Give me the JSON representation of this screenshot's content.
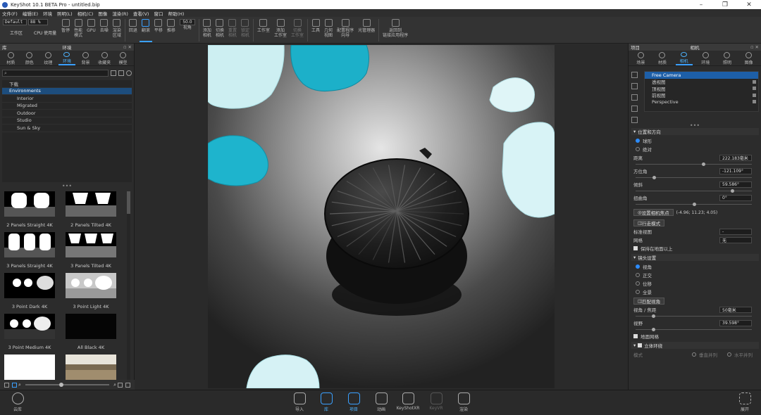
{
  "window": {
    "title": "KeyShot 10.1 BETA Pro  - untitled.bip",
    "minimize": "–",
    "restore": "❐",
    "close": "✕"
  },
  "menu": [
    "文件(F)",
    "编辑(E)",
    "环境",
    "照明(L)",
    "相机(C)",
    "图像",
    "渲染(R)",
    "查看(V)",
    "窗口",
    "帮助(H)"
  ],
  "toolbar": {
    "preset": "Default",
    "zoom": "88 %",
    "workspace_label": "工作区",
    "cpu_label": "CPU 使用量",
    "fov_value": "50.0",
    "buttons": [
      {
        "key": "pause",
        "label": "暂停"
      },
      {
        "key": "perf",
        "label": "性能\n模式"
      },
      {
        "key": "gpu",
        "label": "GPU"
      },
      {
        "key": "denoise",
        "label": "去噪"
      },
      {
        "key": "region",
        "label": "渲染\n区域"
      },
      {
        "key": "sep1",
        "label": ""
      },
      {
        "key": "back",
        "label": "回退"
      },
      {
        "key": "tumble",
        "label": "翻滚",
        "active": true
      },
      {
        "key": "pan",
        "label": "平移"
      },
      {
        "key": "dolly",
        "label": "推移"
      },
      {
        "key": "fov",
        "label": "视角"
      },
      {
        "key": "sep2",
        "label": ""
      },
      {
        "key": "addcam",
        "label": "添加\n相机"
      },
      {
        "key": "switchcam",
        "label": "切换\n相机"
      },
      {
        "key": "resetcam",
        "label": "重置\n相机",
        "dim": true
      },
      {
        "key": "lockcam",
        "label": "锁定\n相机",
        "dim": true
      },
      {
        "key": "sep3",
        "label": ""
      },
      {
        "key": "studio",
        "label": "工作室"
      },
      {
        "key": "addstudio",
        "label": "添加\n工作室"
      },
      {
        "key": "switchstudio",
        "label": "切换\n工作室",
        "dim": true
      },
      {
        "key": "sep4",
        "label": ""
      },
      {
        "key": "tools",
        "label": "工具"
      },
      {
        "key": "geoview",
        "label": "几何\n视图"
      },
      {
        "key": "wizard",
        "label": "配置程序\n向导"
      },
      {
        "key": "lightmgr",
        "label": "光管理器"
      },
      {
        "key": "sep5",
        "label": ""
      },
      {
        "key": "returnlink",
        "label": "返回到\n链接应用程序"
      }
    ]
  },
  "library": {
    "header": "库",
    "title": "环境",
    "tabs": [
      {
        "label": "材质"
      },
      {
        "label": "颜色"
      },
      {
        "label": "纹理"
      },
      {
        "label": "环境",
        "active": true
      },
      {
        "label": "背景"
      },
      {
        "label": "收藏夹"
      },
      {
        "label": "模型"
      }
    ],
    "search_placeholder": "",
    "tree": [
      {
        "label": "下载",
        "indent": 0
      },
      {
        "label": "Environments",
        "indent": 0,
        "selected": true
      },
      {
        "label": "Interior",
        "indent": 1
      },
      {
        "label": "Migrated",
        "indent": 1
      },
      {
        "label": "Outdoor",
        "indent": 1
      },
      {
        "label": "Studio",
        "indent": 1
      },
      {
        "label": "Sun & Sky",
        "indent": 1
      }
    ],
    "grip": "•••",
    "thumbnails": [
      {
        "label": "2 Panels Straight 4K",
        "kind": "2ps"
      },
      {
        "label": "2 Panels Tilted 4K",
        "kind": "2pt"
      },
      {
        "label": "3 Panels Straight 4K",
        "kind": "3ps"
      },
      {
        "label": "3 Panels Tilted 4K",
        "kind": "3pt"
      },
      {
        "label": "3 Point Dark 4K",
        "kind": "3pd"
      },
      {
        "label": "3 Point Light 4K",
        "kind": "3pl"
      },
      {
        "label": "3 Point Medium 4K",
        "kind": "3pm"
      },
      {
        "label": "All Black 4K",
        "kind": "black"
      },
      {
        "label": "",
        "kind": "white"
      },
      {
        "label": "",
        "kind": "outdoor"
      }
    ]
  },
  "project": {
    "header": "项目",
    "title": "相机",
    "tabs": [
      {
        "label": "场景"
      },
      {
        "label": "材质"
      },
      {
        "label": "相机",
        "active": true
      },
      {
        "label": "环境"
      },
      {
        "label": "照明"
      },
      {
        "label": "图像"
      }
    ],
    "cameras": [
      {
        "label": "Free Camera",
        "selected": true
      },
      {
        "label": "透视图",
        "locked": true
      },
      {
        "label": "顶视图",
        "locked": true
      },
      {
        "label": "前视图",
        "locked": true
      },
      {
        "label": "Perspective",
        "locked": true
      }
    ],
    "grip": "•••",
    "pos_section": "位置和方向",
    "mode_orbit": "球形",
    "mode_absolute": "绝对",
    "distance_label": "距离",
    "distance_value": "222.183毫米",
    "distance_pct": 0.58,
    "azimuth_label": "方位角",
    "azimuth_value": "-121.109°",
    "azimuth_pct": 0.16,
    "incl_label": "倾斜",
    "incl_value": "59.586°",
    "incl_pct": 0.83,
    "twist_label": "扭曲角",
    "twist_value": "0°",
    "twist_pct": 0.5,
    "focus_btn": "设置相机焦点",
    "focus_coords": "(-4.96; 11.23; 4.05)",
    "walk_btn": "行走模式",
    "std_view_label": "标准视图",
    "std_view_value": "-",
    "grid_label": "网格",
    "grid_value": "无",
    "keep_ground": "保持在地面以上",
    "lens_section": "镜头设置",
    "lens_options": [
      {
        "label": "视角",
        "on": true
      },
      {
        "label": "正交"
      },
      {
        "label": "位移"
      },
      {
        "label": "全景"
      }
    ],
    "match_btn": "匹配视角",
    "focal_label": "视角 / 焦距",
    "focal_value": "50毫米",
    "focal_pct": 0.15,
    "fov_label": "视野",
    "fov_value": "39.598°",
    "fov_pct": 0.15,
    "grid_overlay": "地面网格",
    "stereo_section": "立体环绕",
    "stereo_mode": "模式",
    "stereo_opt1": "垂直并列",
    "stereo_opt2": "水平并列"
  },
  "bottom": {
    "cloud": "云库",
    "buttons": [
      {
        "label": "导入"
      },
      {
        "label": "库",
        "active": true
      },
      {
        "label": "项目",
        "active": true
      },
      {
        "label": "动画"
      },
      {
        "label": "KeyShotXR"
      },
      {
        "label": "KeyVR",
        "dim": true
      },
      {
        "label": "渲染"
      }
    ],
    "expand": "展开"
  },
  "scene": {
    "shell_dark": "#1c1c1c",
    "shell_cyan": "#1fb4cc",
    "shell_light": "#cff0f3"
  }
}
